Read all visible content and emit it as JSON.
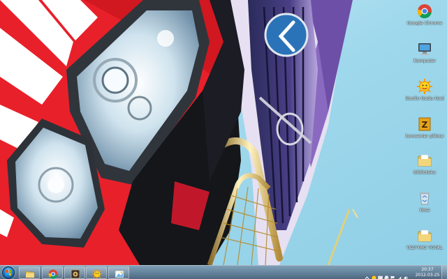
{
  "desktop": {
    "icons": [
      {
        "label": "Google Chrome",
        "icon": "chrome-icon"
      },
      {
        "label": "Komputer",
        "icon": "computer-icon"
      },
      {
        "label": "Studio Gadu-Gadu",
        "icon": "gadu-gadu-sun-icon"
      },
      {
        "label": "konwerter plikow",
        "icon": "zip-archive-icon"
      },
      {
        "label": "biblioteka",
        "icon": "folder-icon"
      },
      {
        "label": "Kosz",
        "icon": "recycle-bin-icon"
      },
      {
        "label": "WZTYRO TOTAL",
        "icon": "folder-icon"
      }
    ]
  },
  "taskbar": {
    "start_icon": "windows-start-orb",
    "pinned": [
      {
        "icon": "file-explorer-icon"
      },
      {
        "icon": "chrome-icon"
      },
      {
        "icon": "media-app-icon"
      },
      {
        "icon": "gadu-gadu-sun-icon"
      },
      {
        "icon": "paint-icon"
      }
    ],
    "tray": {
      "icons": [
        "tray-expand-icon",
        "gadu-gadu-tray-icon",
        "network-tray-icon",
        "printer-tray-icon",
        "flag-tray-icon",
        "signal-tray-icon",
        "volume-tray-icon"
      ],
      "time": "20:37",
      "date": "2012-03-25"
    }
  },
  "colors": {
    "taskbar": "#5a7a98",
    "sky": "#9fd6ea",
    "truck_red": "#e8202a"
  }
}
